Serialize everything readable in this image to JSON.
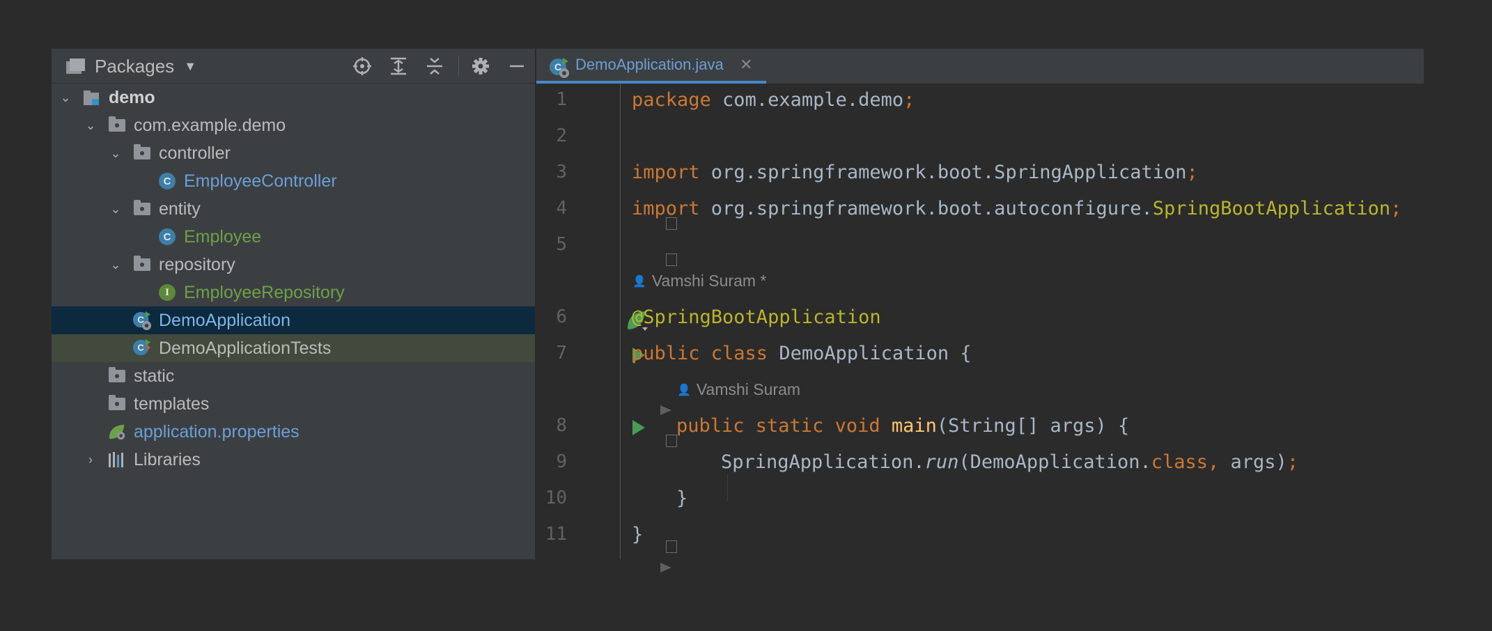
{
  "project_panel": {
    "title": "Packages",
    "toolbar_icons": [
      "crosshair-icon",
      "expand-all-icon",
      "collapse-all-icon",
      "gear-icon",
      "minimize-icon"
    ],
    "tree": [
      {
        "label": "demo",
        "level": 0,
        "icon": "module-folder-icon",
        "expanded": true
      },
      {
        "label": "com.example.demo",
        "level": 1,
        "icon": "package-icon",
        "expanded": true
      },
      {
        "label": "controller",
        "level": 2,
        "icon": "package-icon",
        "expanded": true
      },
      {
        "label": "EmployeeController",
        "level": 3,
        "icon": "class-icon"
      },
      {
        "label": "entity",
        "level": 2,
        "icon": "package-icon",
        "expanded": true
      },
      {
        "label": "Employee",
        "level": 3,
        "icon": "class-icon"
      },
      {
        "label": "repository",
        "level": 2,
        "icon": "package-icon",
        "expanded": true
      },
      {
        "label": "EmployeeRepository",
        "level": 3,
        "icon": "interface-icon"
      },
      {
        "label": "DemoApplication",
        "level": 2,
        "icon": "spring-class-icon",
        "selected": true
      },
      {
        "label": "DemoApplicationTests",
        "level": 2,
        "icon": "spring-class-icon"
      },
      {
        "label": "static",
        "level": 1,
        "icon": "folder-icon"
      },
      {
        "label": "templates",
        "level": 1,
        "icon": "folder-icon"
      },
      {
        "label": "application.properties",
        "level": 1,
        "icon": "spring-properties-icon"
      },
      {
        "label": "Libraries",
        "level": 1,
        "icon": "libraries-icon",
        "expanded": false
      }
    ]
  },
  "editor": {
    "tab": {
      "label": "DemoApplication.java",
      "close": "✕"
    },
    "line_numbers": [
      "1",
      "2",
      "3",
      "4",
      "5",
      "6",
      "7",
      "8",
      "9",
      "10",
      "11"
    ],
    "hints": {
      "author_class": "Vamshi Suram *",
      "author_method": "Vamshi Suram"
    },
    "code": {
      "l1_kw": "package",
      "l1_rest": " com.example.demo",
      "l1_semi": ";",
      "l3_kw": "import",
      "l3_rest": " org.springframework.boot.SpringApplication",
      "l3_semi": ";",
      "l4_kw": "import",
      "l4_rest": " org.springframework.boot.autoconfigure.",
      "l4_an": "SpringBootApplication",
      "l4_semi": ";",
      "l6_an": "@SpringBootApplication",
      "l7_kw": "public class",
      "l7_rest": " DemoApplication {",
      "l8_kw": "public static void",
      "l8_fn": "main",
      "l8_rest": "(String[] args) {",
      "l9_cls": "SpringApplication.",
      "l9_run": "run",
      "l9_args": "(DemoApplication.",
      "l9_kw": "class",
      "l9_comma": ",",
      "l9_end": " args)",
      "l9_semi": ";",
      "l10": "}",
      "l11": "}"
    }
  },
  "colors": {
    "keyword": "#cc7832",
    "annotation": "#bbb529",
    "method": "#ffc66d",
    "text": "#a9b7c6",
    "selection": "#0d293e",
    "run": "#499c54"
  }
}
